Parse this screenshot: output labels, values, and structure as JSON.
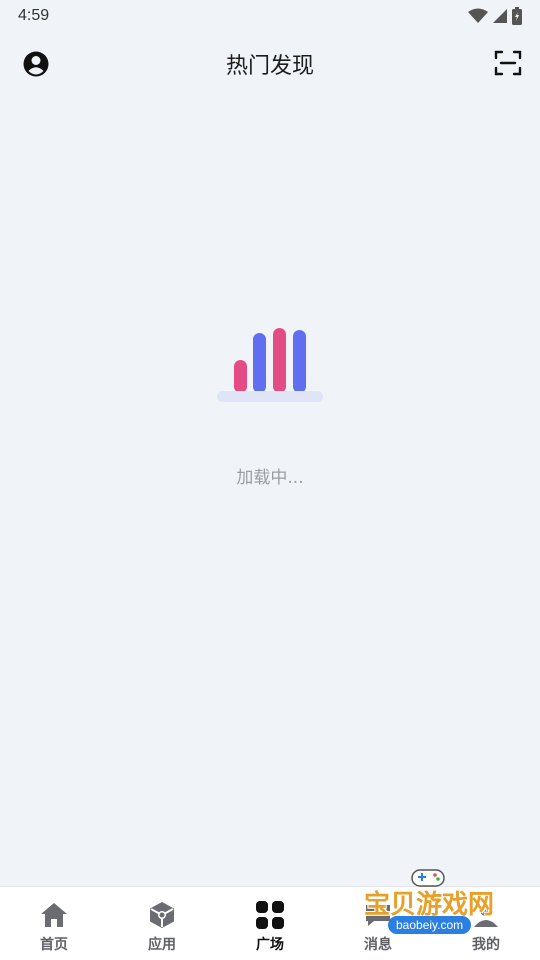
{
  "status_bar": {
    "time": "4:59"
  },
  "header": {
    "title": "热门发现"
  },
  "loading": {
    "text": "加载中..."
  },
  "bottom_nav": {
    "items": [
      {
        "label": "首页",
        "icon": "home-icon"
      },
      {
        "label": "应用",
        "icon": "apps-icon"
      },
      {
        "label": "广场",
        "icon": "grid-icon",
        "active": true
      },
      {
        "label": "消息",
        "icon": "message-icon"
      },
      {
        "label": "我的",
        "icon": "profile-icon"
      }
    ]
  },
  "watermark": {
    "text": "宝贝游戏网",
    "domain": "baobeiy.com"
  },
  "colors": {
    "bar_pink": "#e34c85",
    "bar_blue": "#5f6ff0",
    "base": "#dfe5f4"
  }
}
